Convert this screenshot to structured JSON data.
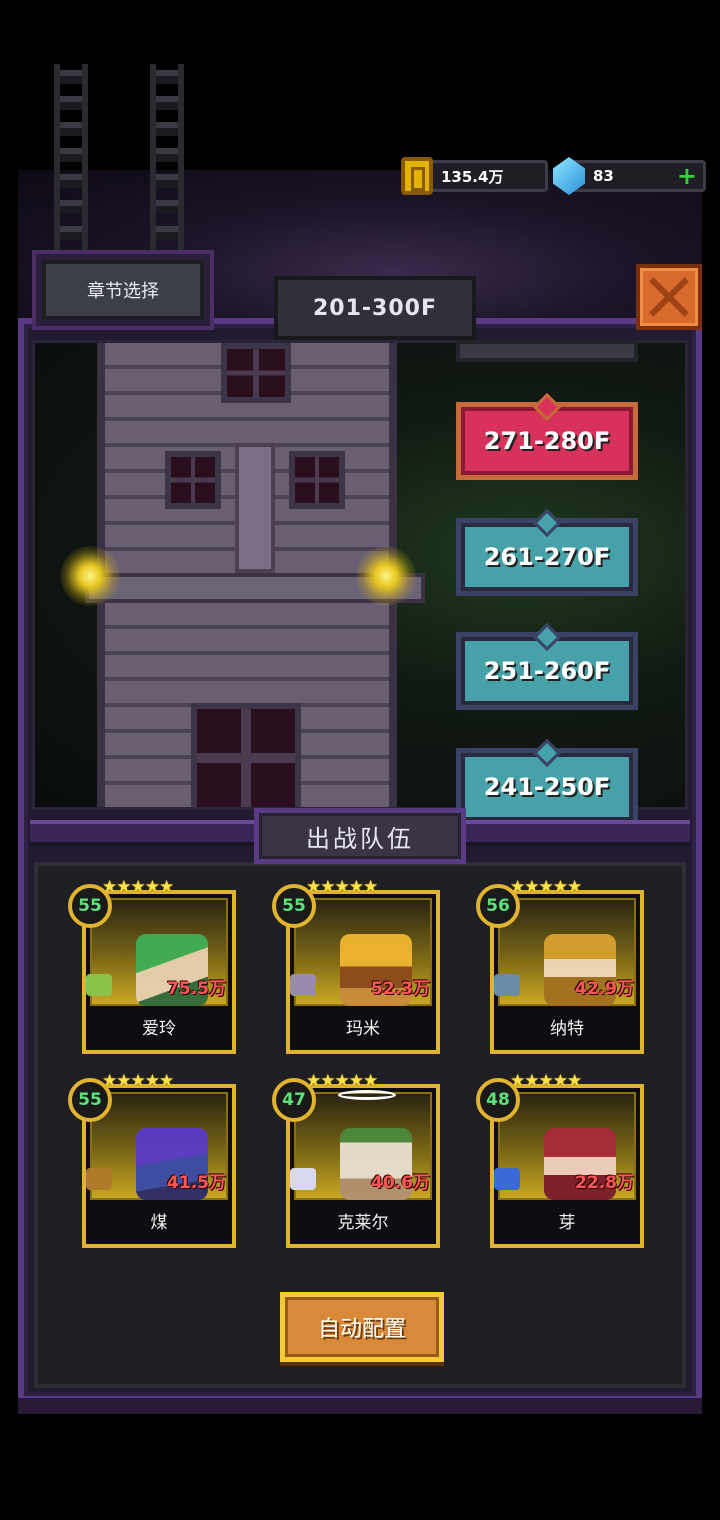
{
  "resources": {
    "gold": "135.4万",
    "gems": "83",
    "add_label": "+"
  },
  "header": {
    "chapter_select": "章节选择",
    "floor_range": "201-300F"
  },
  "floors": [
    {
      "label": "271-280F",
      "state": "active"
    },
    {
      "label": "261-270F",
      "state": "normal"
    },
    {
      "label": "251-260F",
      "state": "normal"
    },
    {
      "label": "241-250F",
      "state": "normal"
    }
  ],
  "team": {
    "title": "出战队伍",
    "auto_button": "自动配置",
    "heroes": [
      {
        "level": "55",
        "power": "75.5万",
        "name": "爱玲",
        "stars": "★★★★★"
      },
      {
        "level": "55",
        "power": "52.3万",
        "name": "玛米",
        "stars": "★★★★★"
      },
      {
        "level": "56",
        "power": "42.9万",
        "name": "纳特",
        "stars": "★★★★★"
      },
      {
        "level": "55",
        "power": "41.5万",
        "name": "煤",
        "stars": "★★★★★"
      },
      {
        "level": "47",
        "power": "40.6万",
        "name": "克莱尔",
        "stars": "★★★★★"
      },
      {
        "level": "48",
        "power": "22.8万",
        "name": "芽",
        "stars": "★★★★★"
      }
    ]
  },
  "colors": {
    "panel_border": "#5a3a82",
    "active_floor": "#d8325a",
    "normal_floor": "#46a2a8",
    "card_gold": "#e0b42e",
    "level_green": "#5fe07a",
    "power_red": "#ff5656"
  },
  "icons": [
    "chain-icon",
    "gold-coin-icon",
    "gem-icon",
    "plus-icon",
    "close-icon",
    "torch-icon",
    "star-icon",
    "class-icon"
  ]
}
